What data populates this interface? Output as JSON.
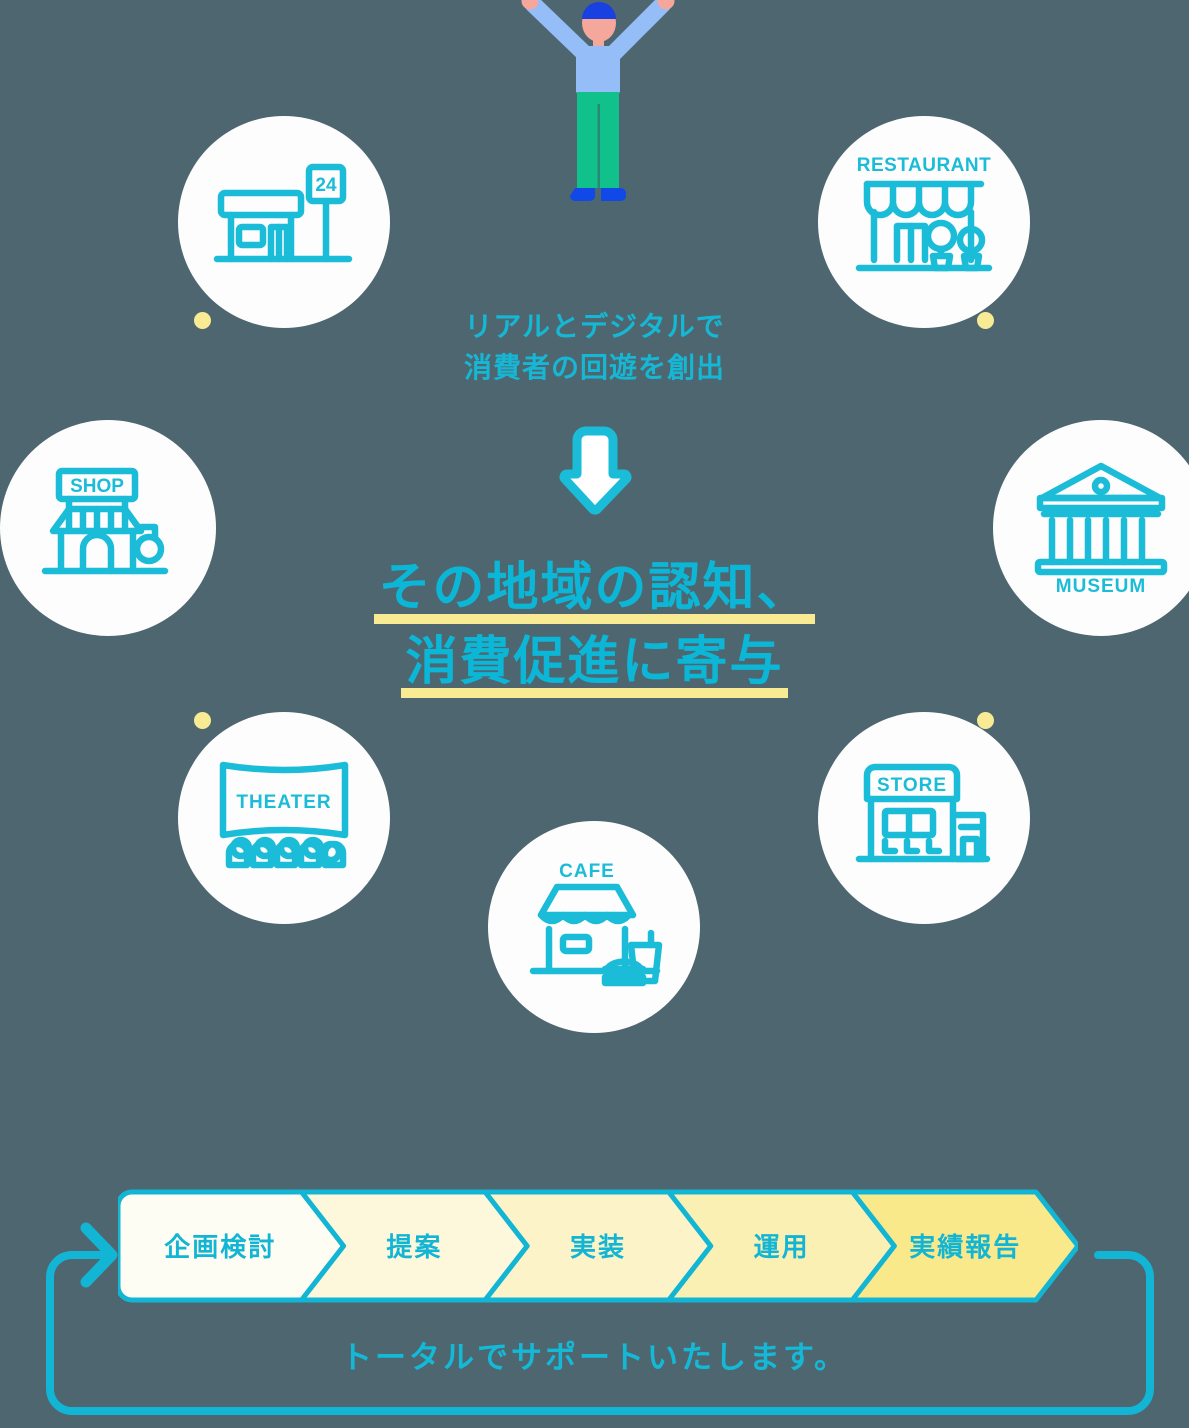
{
  "background_color": "#4d666f",
  "accent_cyan": "#13b5d4",
  "accent_yellow": "#f8eb94",
  "center": {
    "lead_line1": "リアルとデジタルで",
    "lead_line2": "消費者の回遊を創出",
    "arrow": "down-arrow",
    "headline_line1": "その地域の認知、",
    "headline_line2": "消費促進に寄与"
  },
  "person": {
    "name": "cheering-person",
    "cap_color": "#1940e0",
    "skin_color": "#f5a79b",
    "shirt_color": "#95bdf7",
    "pants_color": "#10c18c",
    "shoes_color": "#1049e8"
  },
  "circles": [
    {
      "id": "convenience-store",
      "label": "24",
      "label_position": "sign",
      "icon": "convenience-store-icon"
    },
    {
      "id": "restaurant",
      "label": "RESTAURANT",
      "label_position": "top",
      "icon": "restaurant-icon"
    },
    {
      "id": "shop",
      "label": "SHOP",
      "label_position": "sign",
      "icon": "shop-icon"
    },
    {
      "id": "museum",
      "label": "MUSEUM",
      "label_position": "bottom",
      "icon": "museum-icon"
    },
    {
      "id": "theater",
      "label": "THEATER",
      "label_position": "screen",
      "icon": "theater-icon"
    },
    {
      "id": "cafe",
      "label": "CAFE",
      "label_position": "top",
      "icon": "cafe-icon"
    },
    {
      "id": "store",
      "label": "STORE",
      "label_position": "sign",
      "icon": "store-icon"
    }
  ],
  "process": {
    "steps": [
      {
        "label": "企画検討",
        "fill": "#fefdf3"
      },
      {
        "label": "提案",
        "fill": "#fdf8dc"
      },
      {
        "label": "実装",
        "fill": "#fcf4c8"
      },
      {
        "label": "運用",
        "fill": "#fbf0b4"
      },
      {
        "label": "実績報告",
        "fill": "#fae98b"
      }
    ],
    "loop_arrow": "loop-back-arrow",
    "tagline": "トータルでサポートいたします。"
  }
}
